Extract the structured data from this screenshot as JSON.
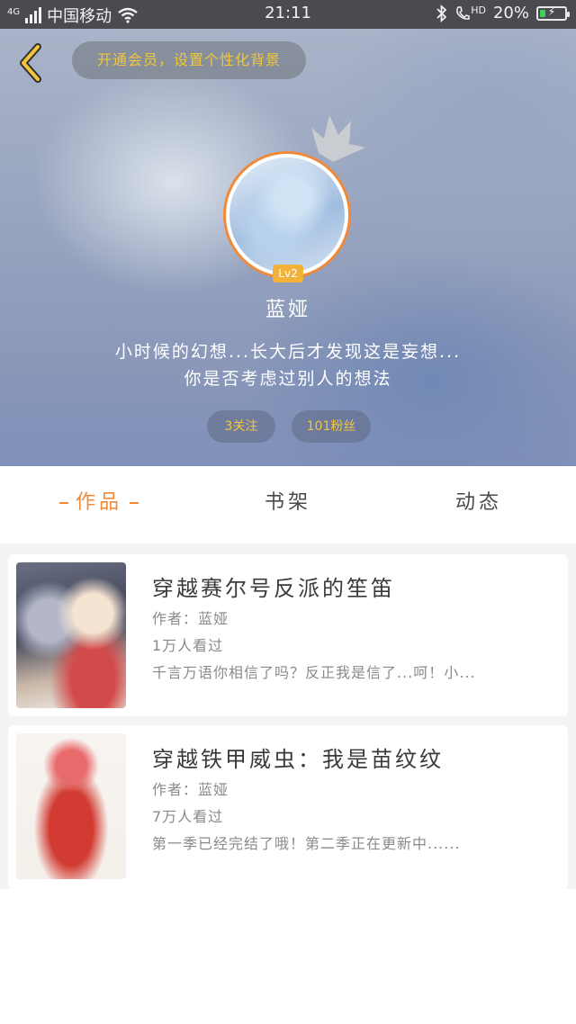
{
  "status_bar": {
    "network_tag": "4G",
    "carrier": "中国移动",
    "time": "21:11",
    "hd_label": "HD",
    "battery_percent": "20%",
    "battery_level": 0.2,
    "icons": [
      "signal-icon",
      "wifi-icon",
      "bluetooth-icon",
      "call-icon",
      "battery-icon"
    ]
  },
  "header": {
    "back_icon": "chevron-left-icon",
    "vip_banner": "开通会员，设置个性化背景",
    "level": "Lv2",
    "nickname": "蓝娅",
    "bio_line1": "小时候的幻想...长大后才发现这是妄想...",
    "bio_line2": "你是否考虑过别人的想法",
    "following": "3关注",
    "fans": "101粉丝"
  },
  "tabs": [
    {
      "label": "作品",
      "active": true
    },
    {
      "label": "书架",
      "active": false
    },
    {
      "label": "动态",
      "active": false
    }
  ],
  "works": [
    {
      "title": "穿越赛尔号反派的笙笛",
      "author": "作者：蓝娅",
      "views": "1万人看过",
      "desc": "千言万语你相信了吗？反正我是信了...呵！小..."
    },
    {
      "title": "穿越铁甲威虫：我是苗纹纹",
      "author": "作者：蓝娅",
      "views": "7万人看过",
      "desc": "第一季已经完结了哦！第二季正在更新中......"
    }
  ],
  "colors": {
    "accent": "#f08a3a",
    "gold": "#f2c63a",
    "status_bar": "#4a4b50",
    "battery": "#3ecf5a"
  }
}
